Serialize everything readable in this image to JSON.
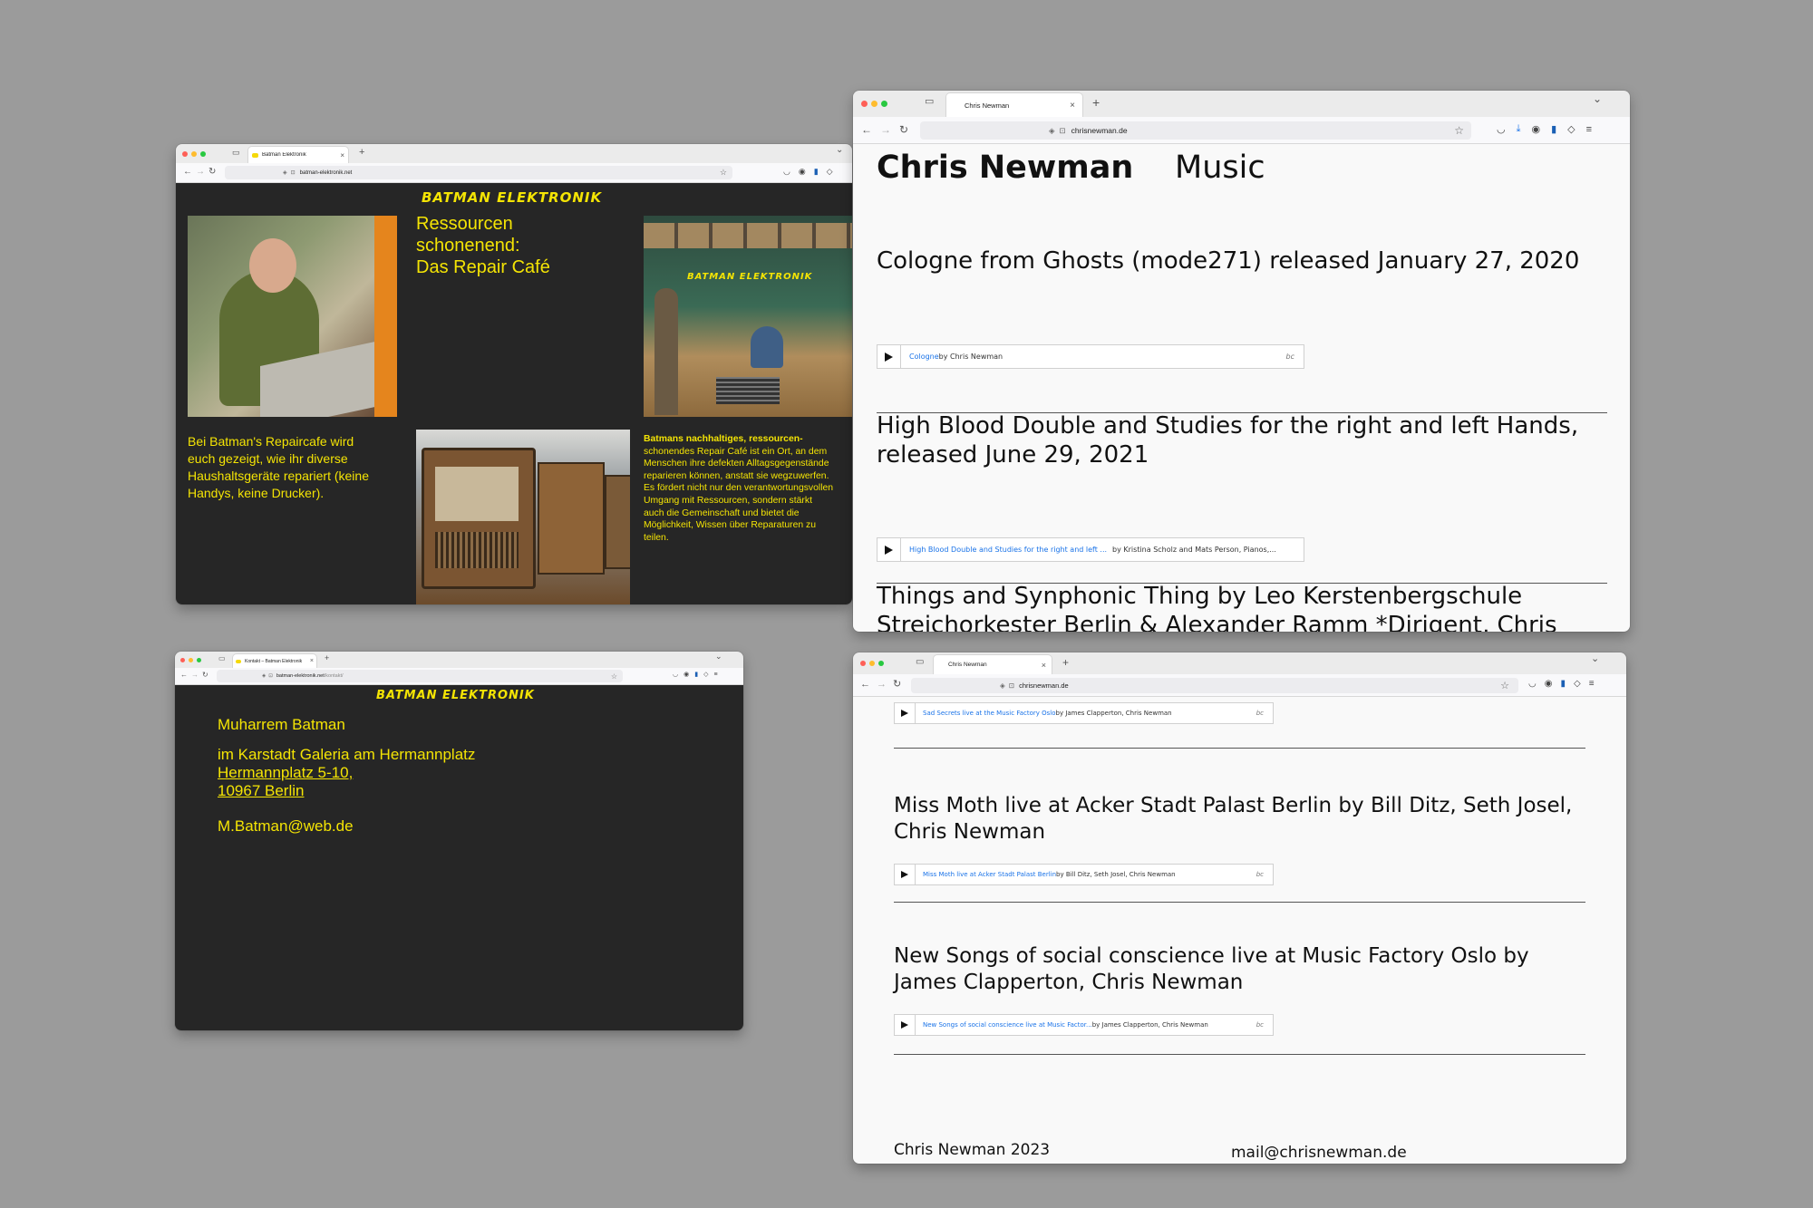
{
  "common": {
    "tab_close": "×",
    "new_tab": "+",
    "chevron": "⌄"
  },
  "win1": {
    "tab_title": "Batman Elektronik",
    "url": "batman-elektronik.net",
    "logo": "BATMAN ELEKTRONIK",
    "headline": [
      "Ressourcen",
      "schonenend:",
      "Das Repair Café"
    ],
    "left_text": [
      "Bei Batman's Repaircafe wird",
      "euch gezeigt, wie ihr diverse",
      "Haushaltsgeräte repariert (keine",
      "Handys, keine Drucker)."
    ],
    "right_text": [
      "Batmans nachhaltiges, ressourcen-",
      "schonendes Repair Café ist ein Ort, an dem",
      "Menschen ihre defekten Alltagsgegenstände",
      "reparieren können, anstatt sie wegzuwerfen.",
      "Es fördert nicht nur den verantwortungsvollen",
      "Umgang mit Ressourcen, sondern stärkt",
      "auch die Gemeinschaft und bietet die",
      "Möglichkeit, Wissen über Reparaturen zu",
      "teilen."
    ],
    "photo_logo": "BATMAN ELEKTRONIK"
  },
  "win2": {
    "tab_title": "Kontakt – Batman Elektronik",
    "url": "batman-elektronik.net",
    "url_path": "/kontakt/",
    "logo": "BATMAN ELEKTRONIK",
    "name": "Muharrem Batman",
    "location": "im Karstadt Galeria am Hermannplatz",
    "street": "Hermannplatz 5-10,",
    "city": "10967 Berlin",
    "email": "M.Batman@web.de"
  },
  "win3": {
    "tab_title": "Chris Newman",
    "url": "chrisnewman.de",
    "site_name": "Chris Newman",
    "nav_music": "Music",
    "releases": [
      {
        "lines": [
          "Cologne from Ghosts (mode271) released January 27, 2020"
        ],
        "embed_title": "Cologne",
        "embed_by": " by Chris Newman"
      },
      {
        "lines": [
          "High Blood Double and Studies for the right and left Hands,",
          "released June 29, 2021"
        ],
        "embed_title": "High Blood Double and Studies for the right and left ...",
        "embed_by": " by Kristina Scholz and Mats Person, Pianos,..."
      },
      {
        "lines": [
          "Things and Synphonic Thing by Leo Kerstenbergschule",
          "Streichorkester Berlin & Alexander Ramm *Dirigent, Chris"
        ]
      }
    ],
    "bc": "bc"
  },
  "win4": {
    "tab_title": "Chris Newman",
    "url": "chrisnewman.de",
    "top_embed_title": "Sad Secrets live at the Music Factory Oslo",
    "top_embed_by": " by James Clapperton, Chris Newman",
    "items": [
      {
        "lines": [
          "Miss Moth live at Acker Stadt Palast Berlin by Bill Ditz, Seth Josel,",
          "Chris Newman"
        ],
        "embed_title": "Miss Moth live at Acker Stadt Palast Berlin",
        "embed_by": " by Bill Ditz, Seth Josel, Chris Newman"
      },
      {
        "lines": [
          "New Songs of social conscience live at Music Factory Oslo by",
          "James Clapperton, Chris Newman"
        ],
        "embed_title": "New Songs of social conscience live at Music Factor...",
        "embed_by": " by James Clapperton, Chris Newman"
      }
    ],
    "footer_left": "Chris Newman 2023",
    "footer_right": "mail@chrisnewman.de",
    "bc": "bc"
  }
}
